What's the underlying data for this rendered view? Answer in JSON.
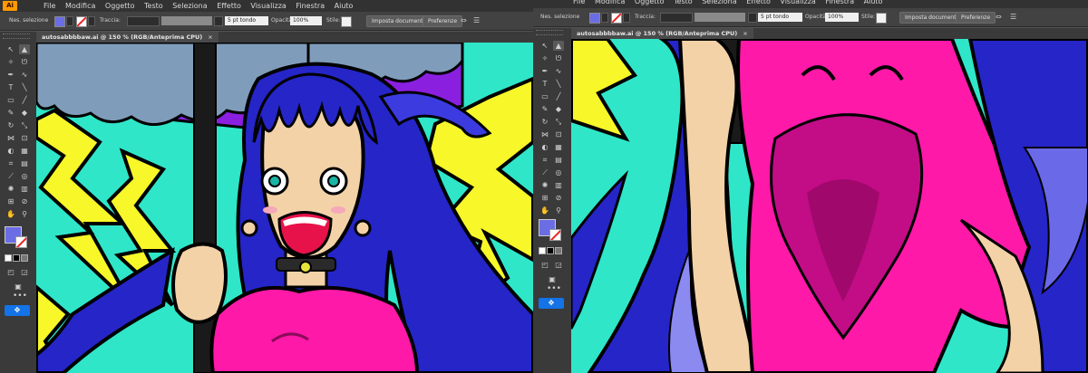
{
  "app": {
    "logo": "Ai"
  },
  "menu": [
    "File",
    "Modifica",
    "Oggetto",
    "Testo",
    "Seleziona",
    "Effetto",
    "Visualizza",
    "Finestra",
    "Aiuto"
  ],
  "control": {
    "selection_label": "Nes. selezione",
    "stroke_label": "Traccia:",
    "brush_value": "5 pt tondo",
    "opacity_label": "Opacità:",
    "opacity_value": "100%",
    "style_label": "Stile:",
    "document_setup": "Imposta documento",
    "preferences": "Preferenze"
  },
  "document": {
    "tab_title": "autosabbbbaw.ai @ 150 % (RGB/Anteprima CPU)",
    "close": "×"
  },
  "tools": {
    "more": "•••"
  },
  "colors": {
    "fill": "#6b6de4",
    "accent": "#1473e6",
    "panel": "#535353",
    "menubar": "#323232"
  }
}
